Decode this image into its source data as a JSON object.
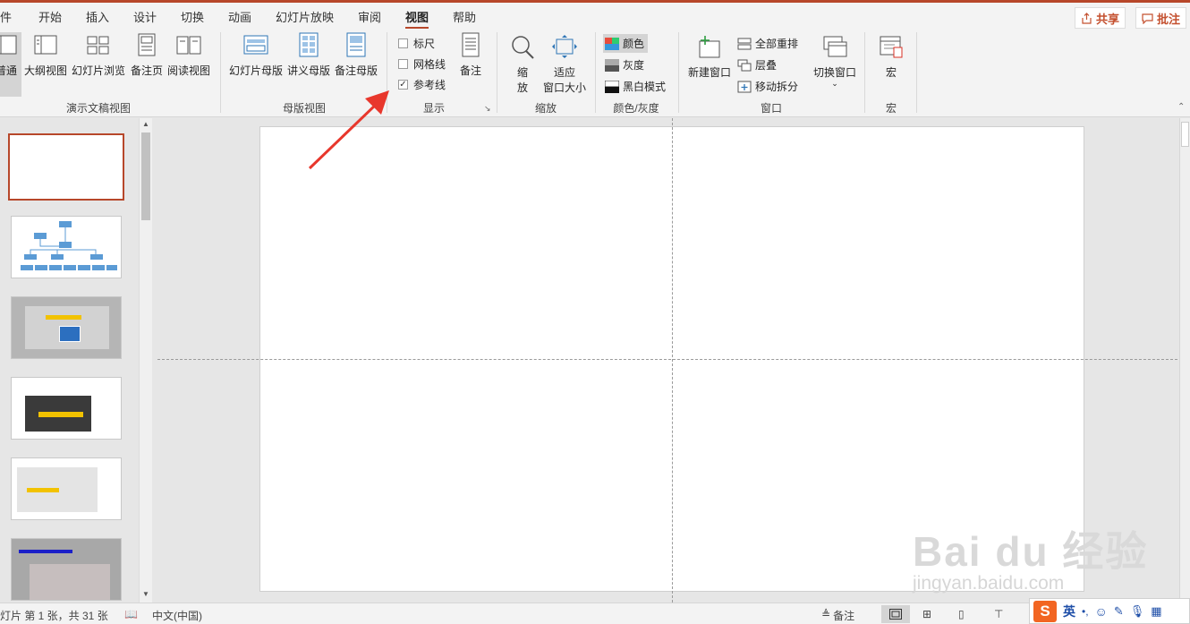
{
  "tabs": [
    "件",
    "开始",
    "插入",
    "设计",
    "切换",
    "动画",
    "幻灯片放映",
    "审阅",
    "视图",
    "帮助"
  ],
  "active_tab": "视图",
  "top_right": {
    "share": "共享",
    "comment": "批注"
  },
  "ribbon": {
    "presentation_views": {
      "title": "演示文稿视图",
      "items": [
        "普通",
        "大纲视图",
        "幻灯片浏览",
        "备注页",
        "阅读视图"
      ]
    },
    "master_views": {
      "title": "母版视图",
      "items": [
        "幻灯片母版",
        "讲义母版",
        "备注母版"
      ]
    },
    "show": {
      "title": "显示",
      "checkboxes": [
        {
          "label": "标尺",
          "checked": false
        },
        {
          "label": "网格线",
          "checked": false
        },
        {
          "label": "参考线",
          "checked": true
        }
      ],
      "notes": "备注"
    },
    "zoom": {
      "title": "缩放",
      "zoom_label": "缩\n放",
      "fit_label_1": "适应",
      "fit_label_2": "窗口大小"
    },
    "color": {
      "title": "颜色/灰度",
      "items": [
        "颜色",
        "灰度",
        "黑白模式"
      ]
    },
    "window": {
      "title": "窗口",
      "new_window": "新建窗口",
      "items": [
        "全部重排",
        "层叠",
        "移动拆分"
      ],
      "switch": "切换窗口"
    },
    "macro": {
      "title": "宏",
      "label": "宏"
    }
  },
  "status": {
    "slide_info": "灯片 第 1 张，共 31 张",
    "language": "中文(中国)",
    "notes": "备注"
  },
  "ime": {
    "lang": "英",
    "punct": "•,"
  },
  "watermark": {
    "line1": "Bai du 经验",
    "line2": "jingyan.baidu.com"
  },
  "colors": {
    "accent": "#b7472a",
    "ribbon_bg": "#f3f3f3",
    "arrow": "#e8372c"
  }
}
